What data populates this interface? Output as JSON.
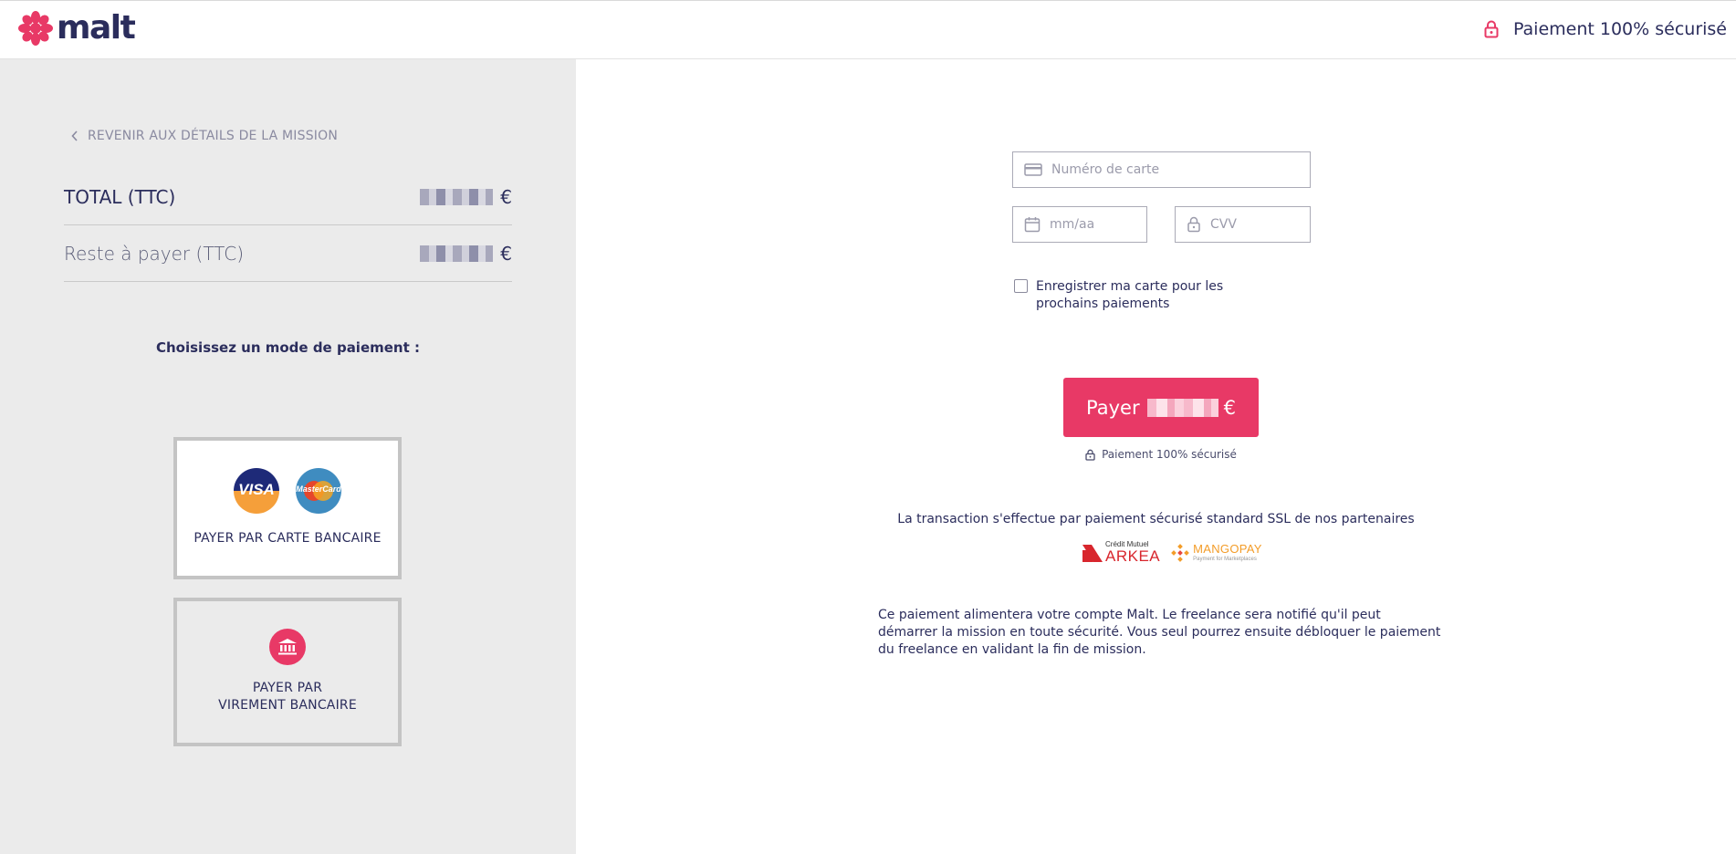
{
  "brand": {
    "logo_text": "malt",
    "accent_color": "#e83966",
    "text_color": "#2b2d5c"
  },
  "header": {
    "secure_label": "Paiement 100% sécurisé"
  },
  "sidebar": {
    "back_link": "REVENIR AUX DÉTAILS DE LA MISSION",
    "total_label": "TOTAL (TTC)",
    "remaining_label": "Reste à payer (TTC)",
    "currency": "€",
    "choose_label": "Choisissez un mode de paiement :",
    "options": [
      {
        "label": "PAYER PAR CARTE BANCAIRE",
        "logos": [
          "VISA",
          "MasterCard"
        ],
        "selected": true
      },
      {
        "label": "PAYER PAR VIREMENT BANCAIRE",
        "icon": "bank-icon",
        "selected": false
      }
    ]
  },
  "form": {
    "card_number_placeholder": "Numéro de carte",
    "expiry_placeholder": "mm/aa",
    "cvv_placeholder": "CVV",
    "save_card_label": "Enregistrer ma carte pour les prochains paiements",
    "save_card_checked": false,
    "pay_label": "Payer",
    "currency": "€",
    "secure_note": "Paiement 100% sécurisé"
  },
  "partners": {
    "ssl_text": "La transaction s'effectue par paiement sécurisé standard SSL de nos partenaires",
    "arkea_top": "Crédit Mutuel",
    "arkea_name": "ARKEA",
    "mangopay_name": "MANGOPAY",
    "mangopay_tagline": "Payment for Marketplaces"
  },
  "info_text": "Ce paiement alimentera votre compte Malt. Le freelance sera notifié qu'il peut démarrer la mission en toute sécurité. Vous seul pourrez ensuite débloquer le paiement du freelance en validant la fin de mission."
}
